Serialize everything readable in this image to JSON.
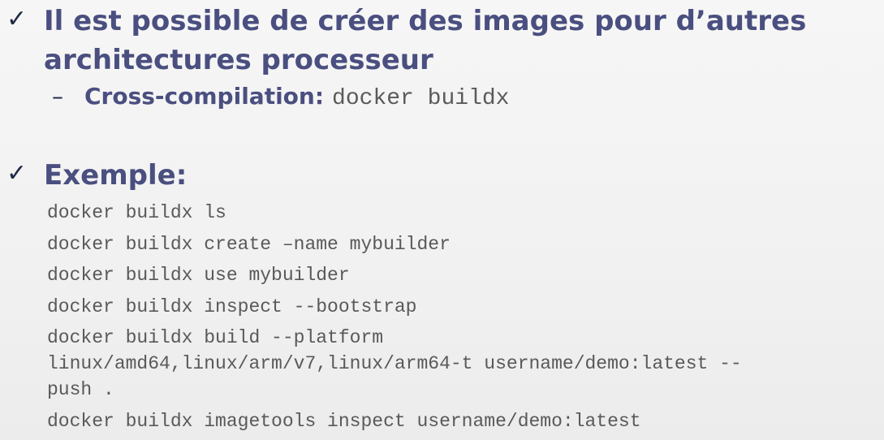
{
  "slide": {
    "bullets": [
      {
        "check": "✓",
        "heading_line1": "Il est possible de créer des images pour d’autres",
        "heading_line2": "architectures processeur"
      },
      {
        "check": "✓",
        "heading_line1": "Exemple:"
      }
    ],
    "sub_bullet": {
      "dash": "–",
      "label": "Cross-compilation:",
      "code": "docker buildx"
    },
    "code_lines": [
      "docker buildx ls",
      "docker buildx create –name mybuilder",
      "docker buildx use mybuilder",
      "docker buildx inspect --bootstrap",
      "docker buildx build --platform\nlinux/amd64,linux/arm/v7,linux/arm64-t username/demo:latest --\npush .",
      "docker buildx imagetools inspect username/demo:latest"
    ]
  }
}
